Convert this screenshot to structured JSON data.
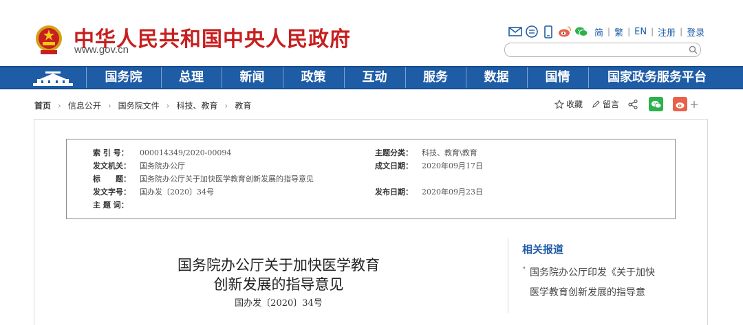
{
  "header": {
    "site_title": "中华人民共和国中央人民政府",
    "site_url": "www.gov.cn",
    "tool_icons": [
      "mail-icon",
      "message-icon",
      "mobile-icon",
      "weibo-icon",
      "wechat-icon"
    ],
    "links": [
      "简",
      "繁",
      "EN",
      "注册",
      "登录"
    ],
    "search": {
      "value": "",
      "placeholder": ""
    }
  },
  "nav": {
    "items": [
      "国务院",
      "总理",
      "新闻",
      "政策",
      "互动",
      "服务",
      "数据",
      "国情",
      "国家政务服务平台"
    ]
  },
  "breadcrumb": {
    "home": "首页",
    "items": [
      "信息公开",
      "国务院文件",
      "科技、教育",
      "教育"
    ]
  },
  "actions": {
    "favorite": "收藏",
    "comment": "留言"
  },
  "info": {
    "index_label": "索 引 号：",
    "index_value": "000014349/2020-00094",
    "issuer_label": "发文机关：",
    "issuer_value": "国务院办公厅",
    "title_label": "标　　题：",
    "title_value": "国务院办公厅关于加快医学教育创新发展的指导意见",
    "docno_label": "发文字号：",
    "docno_value": "国办发〔2020〕34号",
    "keywords_label": "主 题 词：",
    "keywords_value": "",
    "topic_label": "主题分类：",
    "topic_value": "科技、教育\\教育",
    "created_label": "成文日期：",
    "created_value": "2020年09月17日",
    "published_label": "发布日期：",
    "published_value": "2020年09月23日"
  },
  "document": {
    "title_line1": "国务院办公厅关于加快医学教育",
    "title_line2": "创新发展的指导意见",
    "number": "国办发〔2020〕34号"
  },
  "sidebar": {
    "title": "相关报道",
    "items": [
      {
        "line1": "国务院办公厅印发《关于加快",
        "line2": "医学教育创新发展的指导意"
      }
    ]
  },
  "colors": {
    "brand_red": "#c71f1f",
    "nav_blue": "#1e5ca6",
    "wechat_green": "#2bb24c",
    "weibo_orange": "#e8614a"
  }
}
